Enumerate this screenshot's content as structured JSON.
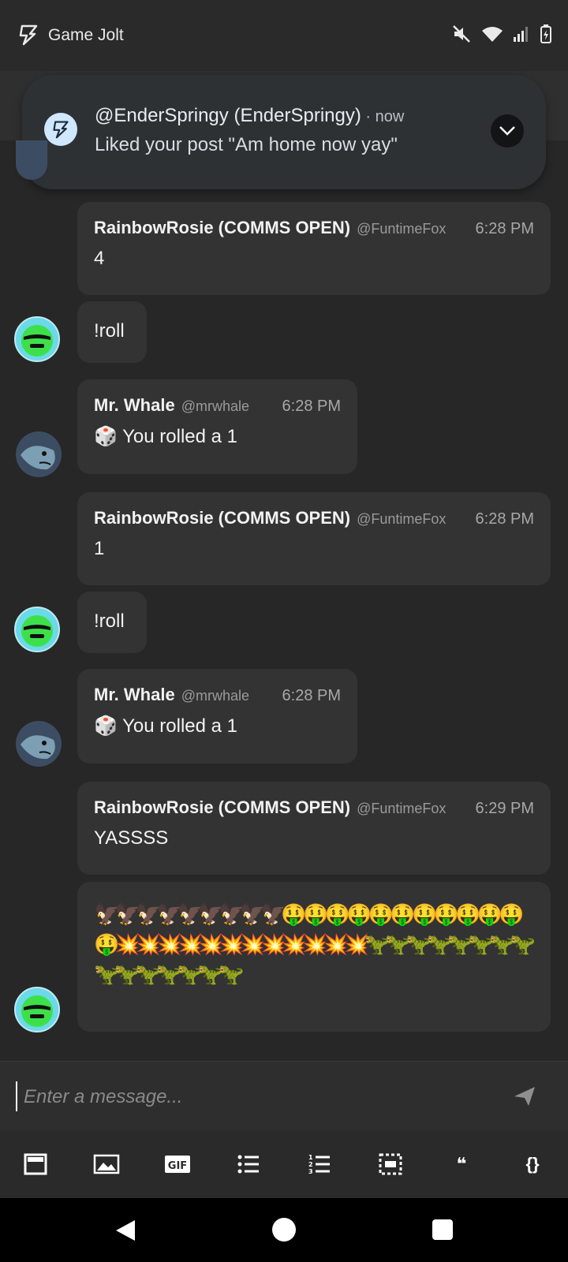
{
  "status_bar": {
    "app_name": "Game Jolt"
  },
  "notification": {
    "title": "@EnderSpringy (EnderSpringy)",
    "separator": " · ",
    "time": "now",
    "body": "Liked your post \"Am home now yay\""
  },
  "messages": [
    {
      "name": "RainbowRosie (COMMS OPEN)",
      "handle": "@FuntimeFox",
      "time": "6:28 PM",
      "text": "4"
    },
    {
      "text": "!roll"
    },
    {
      "name": "Mr. Whale",
      "handle": "@mrwhale",
      "time": "6:28 PM",
      "dice": "🎲",
      "text": "You rolled a 1"
    },
    {
      "name": "RainbowRosie (COMMS OPEN)",
      "handle": "@FuntimeFox",
      "time": "6:28 PM",
      "text": "1"
    },
    {
      "text": "!roll"
    },
    {
      "name": "Mr. Whale",
      "handle": "@mrwhale",
      "time": "6:28 PM",
      "dice": "🎲",
      "text": "You rolled a 1"
    },
    {
      "name": "RainbowRosie (COMMS OPEN)",
      "handle": "@FuntimeFox",
      "time": "6:29 PM",
      "text": "YASSSS"
    },
    {
      "text": "🦅🦅🦅🦅🦅🦅🦅🦅🦅🤑 🤑 🤑 🤑 🤑 🤑 🤑 🤑 🤑 🤑 🤑 🤑💥💥💥💥💥💥💥💥💥💥💥💥🦖🦖🦖🦖🦖🦖🦖🦖🦖🦖🦖🦖🦖🦖🦖"
    }
  ],
  "composer": {
    "placeholder": "Enter a message..."
  },
  "toolbar_icons": [
    "embed-icon",
    "image-icon",
    "gif-icon",
    "bulleted-list-icon",
    "numbered-list-icon",
    "spoiler-icon",
    "quote-icon",
    "code-icon"
  ],
  "toolbar_labels": {
    "gif": "GIF",
    "quote": "❝",
    "code": "{}"
  },
  "colors": {
    "background": "#262726",
    "bubble": "#333333",
    "notification": "#2e3134"
  }
}
